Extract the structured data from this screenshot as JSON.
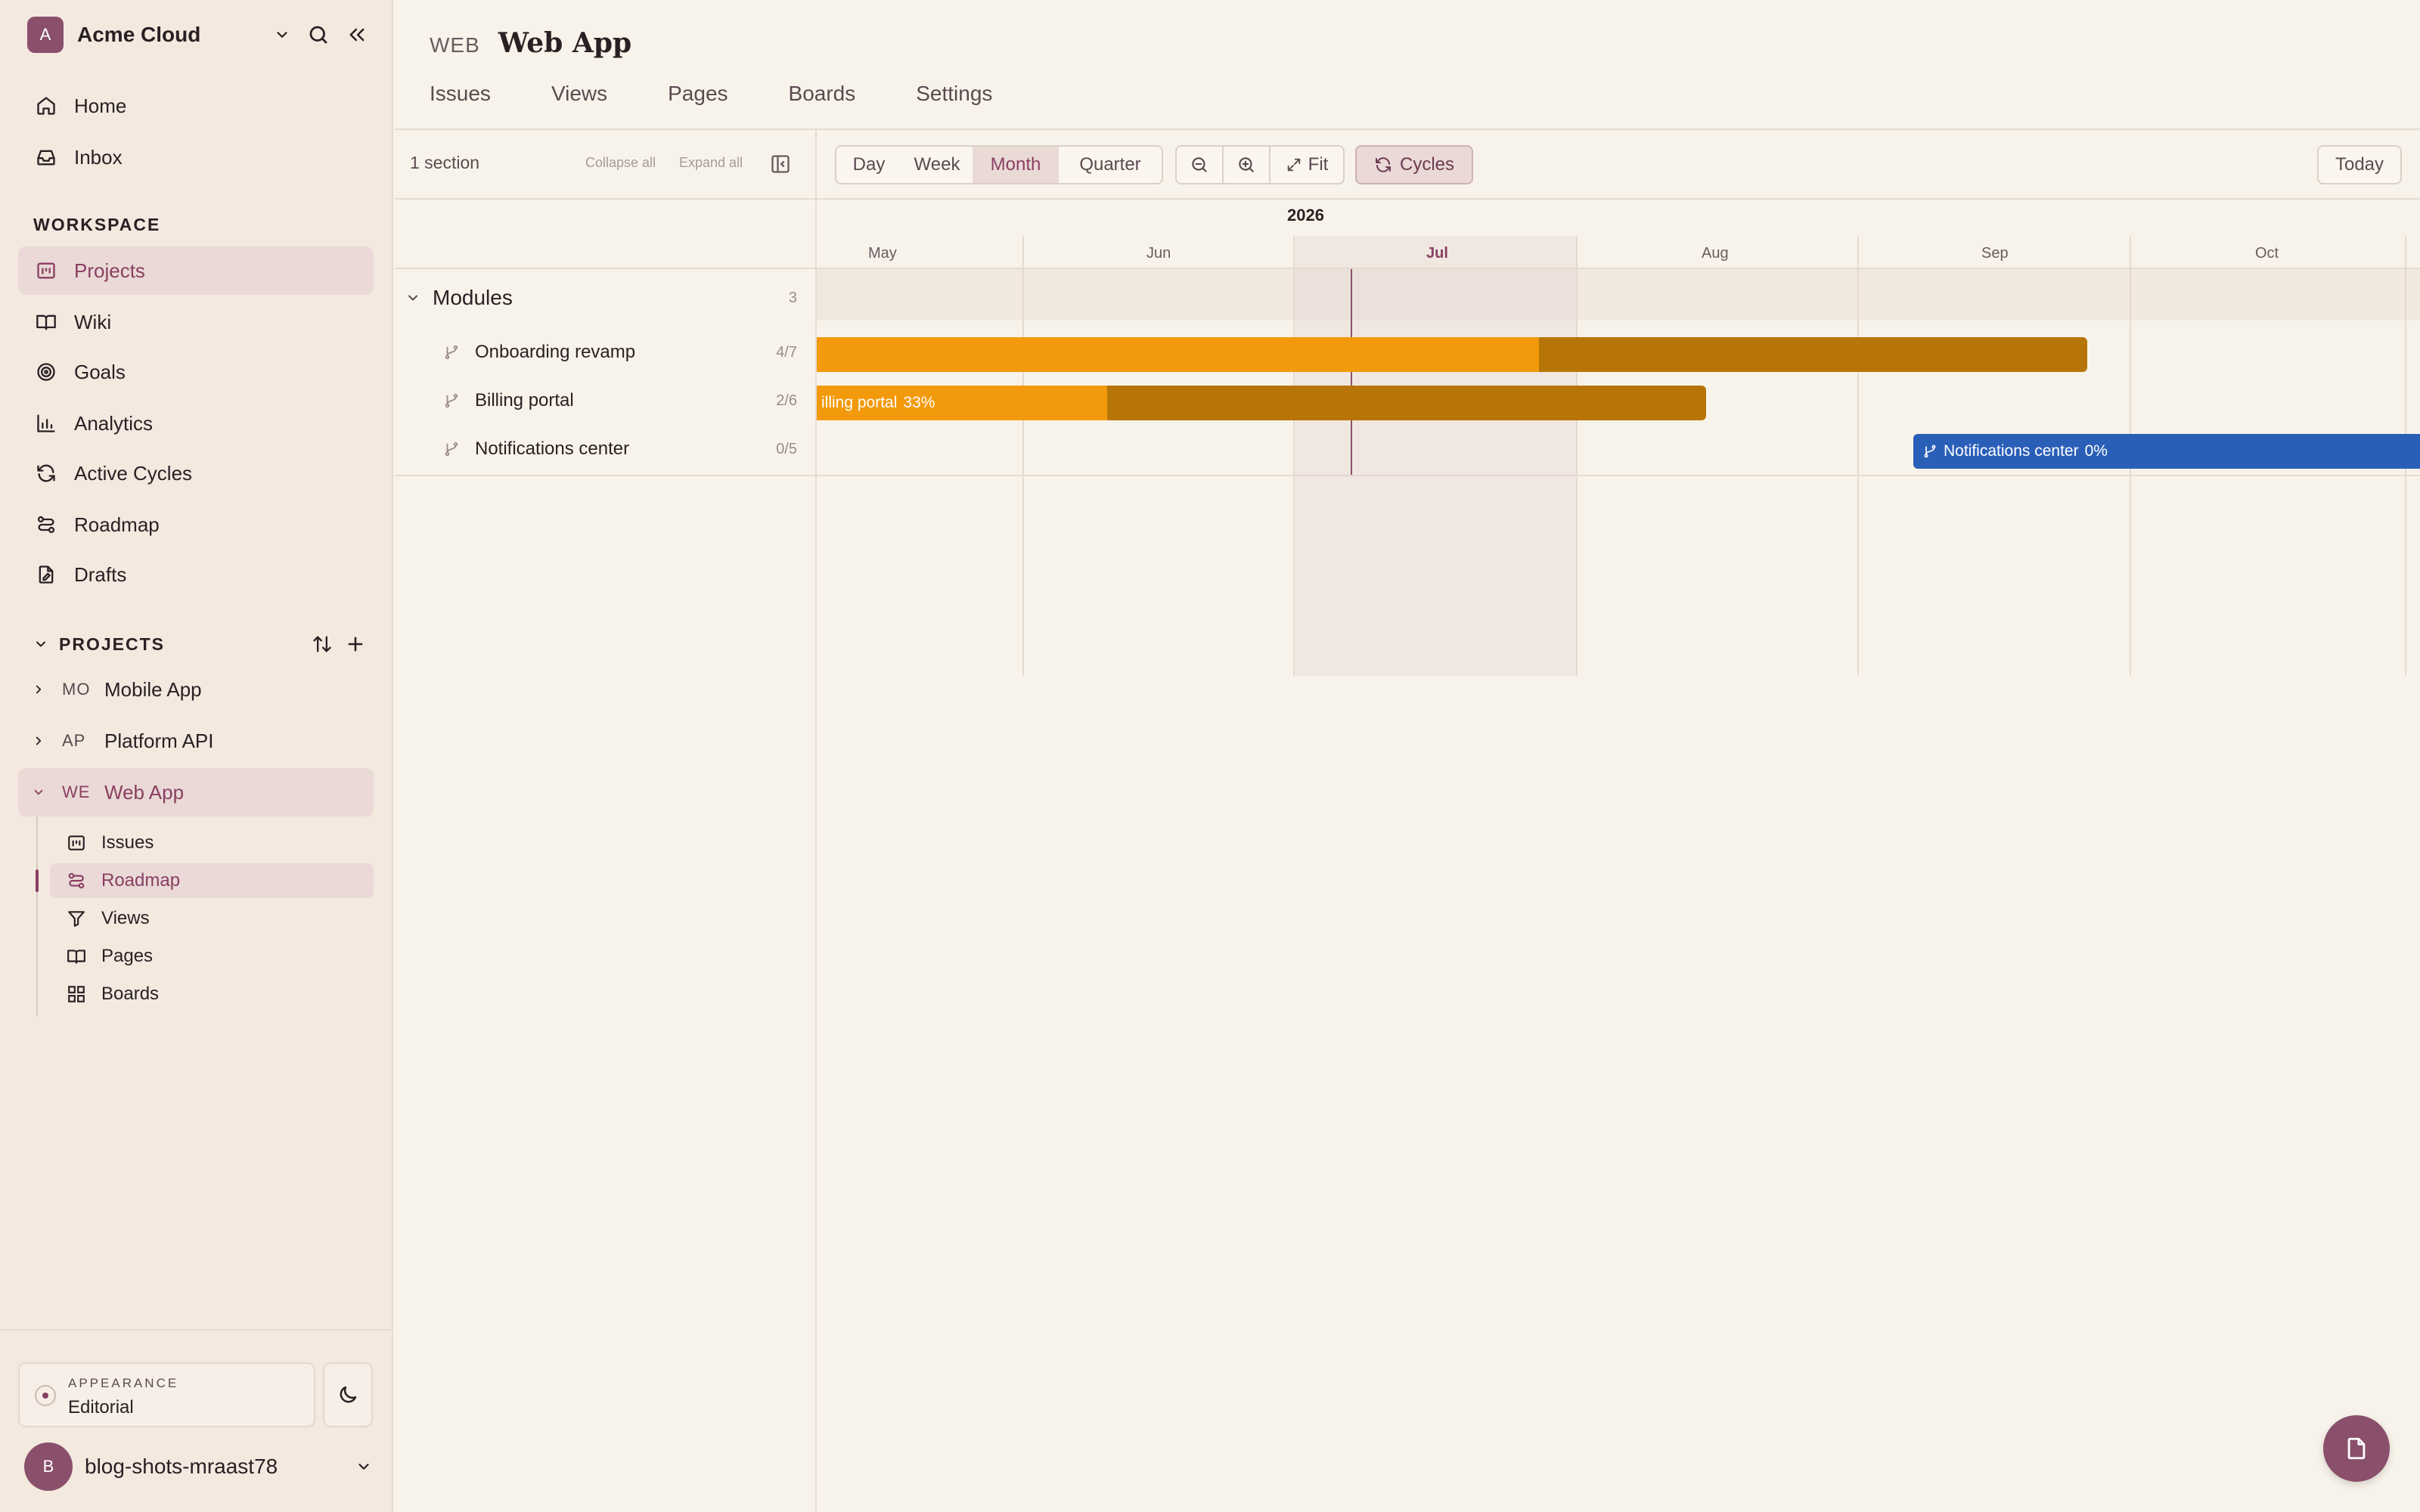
{
  "workspace": {
    "avatar_letter": "A",
    "name": "Acme Cloud"
  },
  "nav": {
    "top": [
      {
        "label": "Home",
        "icon": "home-icon"
      },
      {
        "label": "Inbox",
        "icon": "inbox-icon"
      }
    ],
    "workspace_label": "WORKSPACE",
    "workspace_items": [
      {
        "label": "Projects",
        "icon": "projects-icon",
        "active": true
      },
      {
        "label": "Wiki",
        "icon": "book-icon"
      },
      {
        "label": "Goals",
        "icon": "target-icon"
      },
      {
        "label": "Analytics",
        "icon": "bar-chart-icon"
      },
      {
        "label": "Active Cycles",
        "icon": "refresh-icon"
      },
      {
        "label": "Roadmap",
        "icon": "roadmap-icon"
      },
      {
        "label": "Drafts",
        "icon": "draft-icon"
      }
    ]
  },
  "projects": {
    "label": "PROJECTS",
    "items": [
      {
        "code": "MO",
        "name": "Mobile App",
        "expanded": false
      },
      {
        "code": "AP",
        "name": "Platform API",
        "expanded": false
      },
      {
        "code": "WE",
        "name": "Web App",
        "expanded": true,
        "active": true
      }
    ],
    "subitems": [
      {
        "label": "Issues",
        "icon": "issues-icon"
      },
      {
        "label": "Roadmap",
        "icon": "roadmap-icon",
        "active": true
      },
      {
        "label": "Views",
        "icon": "filter-icon"
      },
      {
        "label": "Pages",
        "icon": "book-icon"
      },
      {
        "label": "Boards",
        "icon": "grid-icon"
      }
    ]
  },
  "appearance": {
    "label": "APPEARANCE",
    "value": "Editorial"
  },
  "user": {
    "avatar_letter": "B",
    "name": "blog-shots-mraast78"
  },
  "header": {
    "project_code": "WEB",
    "project_name": "Web App",
    "tabs": [
      "Issues",
      "Views",
      "Pages",
      "Boards",
      "Settings"
    ]
  },
  "toolbar": {
    "section_count": "1 section",
    "collapse_all": "Collapse all",
    "expand_all": "Expand all",
    "scale_options": [
      "Day",
      "Week",
      "Month",
      "Quarter"
    ],
    "active_scale": "Month",
    "fit_label": "Fit",
    "cycles_label": "Cycles",
    "today_label": "Today"
  },
  "list": {
    "group": {
      "name": "Modules",
      "count": "3"
    },
    "modules": [
      {
        "name": "Onboarding revamp",
        "progress": "4/7"
      },
      {
        "name": "Billing portal",
        "progress": "2/6"
      },
      {
        "name": "Notifications center",
        "progress": "0/5"
      }
    ]
  },
  "timeline": {
    "year": "2026",
    "months": [
      "May",
      "Jun",
      "Jul",
      "Aug",
      "Sep",
      "Oct"
    ],
    "current_month": "Jul",
    "bars": [
      {
        "module": "Onboarding revamp",
        "label": "",
        "percent": 57,
        "color": "#b87507",
        "fill_color": "#f29a0c"
      },
      {
        "module": "Billing portal",
        "label": "illing portal",
        "percent_label": "33%",
        "percent": 33,
        "color": "#b87507",
        "fill_color": "#f29a0c"
      },
      {
        "module": "Notifications center",
        "label": "Notifications center",
        "percent_label": "0%",
        "percent": 0,
        "color": "#2a5fb8",
        "fill_color": "#2a5fb8"
      }
    ]
  },
  "colors": {
    "accent": "#8a3f62",
    "sidebar_bg": "#f3e9df",
    "page_bg": "#f8f3ea",
    "bar_orange_done": "#f29a0c",
    "bar_orange_remaining": "#b87507",
    "bar_blue": "#2a5fb8"
  }
}
